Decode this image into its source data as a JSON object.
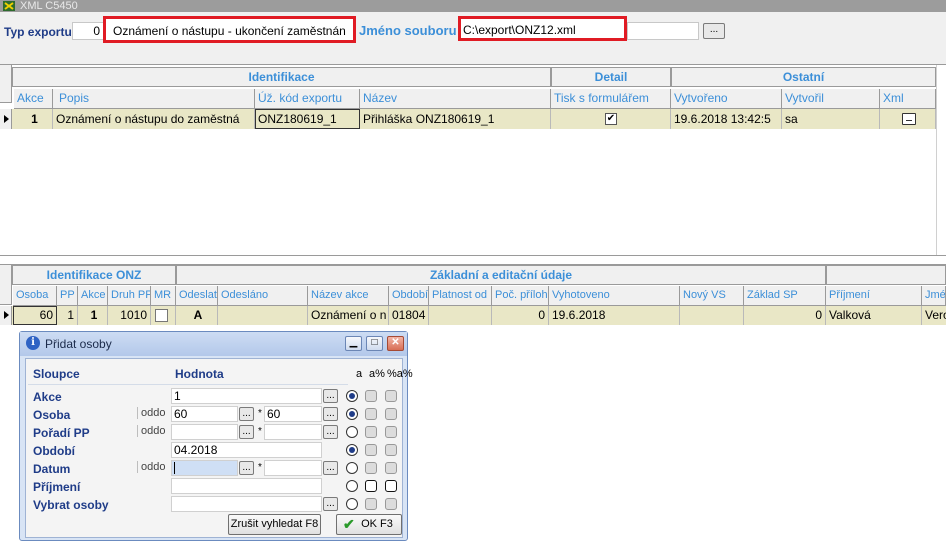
{
  "window": {
    "title": "XML C5450"
  },
  "header": {
    "typ_label": "Typ exportu",
    "typ_value": "0",
    "typ_name": "Oznámení o nástupu - ukončení zaměstnán",
    "jmeno_label": "Jméno souboru",
    "jmeno_value": "C:\\export\\ONZ12.xml",
    "browse_label": "..."
  },
  "grid1": {
    "group_headers": [
      "Identifikace",
      "Detail",
      "Ostatní"
    ],
    "columns": [
      "Akce",
      "Popis",
      "Úž. kód exportu",
      "Název",
      "Tisk s formulářem",
      "Vytvořeno",
      "Vytvořil",
      "Xml"
    ],
    "row": {
      "akce": "1",
      "popis": "Oznámení o nástupu do zaměstná",
      "kod": "ONZ180619_1",
      "nazev": "Přihláška ONZ180619_1",
      "tisk": true,
      "vytvoreno": "19.6.2018 13:42:5",
      "vytvoril": "sa"
    }
  },
  "grid2": {
    "group_headers": [
      "Identifikace ONZ",
      "Základní a editační údaje"
    ],
    "columns": [
      "Osoba",
      "PP",
      "Akce",
      "Druh PP",
      "MR",
      "Odeslat",
      "Odesláno",
      "Název akce",
      "Období",
      "Platnost od",
      "Poč. příloh",
      "Vyhotoveno",
      "Nový VS",
      "Základ SP",
      "Příjmení",
      "Jmé"
    ],
    "row": {
      "osoba": "60",
      "pp": "1",
      "akce": "1",
      "druh_pp": "1010",
      "odeslat": "A",
      "nazev_akce": "Oznámení o n",
      "obdobi": "01804",
      "poc_priloh": "0",
      "vyhotoveno": "19.6.2018",
      "zaklad_sp": "0",
      "prijmeni": "Valková",
      "jmeno": "Vero"
    }
  },
  "dialog": {
    "title": "Přidat osoby",
    "col_sloupce": "Sloupce",
    "col_hodnota": "Hodnota",
    "flag_headers": [
      "a",
      "a%",
      "%a%"
    ],
    "rows": [
      {
        "label": "Akce",
        "oddo": "",
        "value": "1",
        "value2": ""
      },
      {
        "label": "Osoba",
        "oddo": "oddo",
        "value": "60",
        "value2": "60"
      },
      {
        "label": "Pořadí PP",
        "oddo": "oddo",
        "value": "",
        "value2": ""
      },
      {
        "label": "Období",
        "oddo": "",
        "value": "04.2018",
        "value2": ""
      },
      {
        "label": "Datum",
        "oddo": "oddo",
        "value": "",
        "value2": ""
      },
      {
        "label": "Příjmení",
        "oddo": "",
        "value": "",
        "value2": ""
      },
      {
        "label": "Vybrat osoby",
        "oddo": "",
        "value": "",
        "value2": ""
      }
    ],
    "cancel_label": "Zrušit vyhledat F8",
    "ok_label": "OK F3",
    "dots": "...",
    "star": "*"
  }
}
